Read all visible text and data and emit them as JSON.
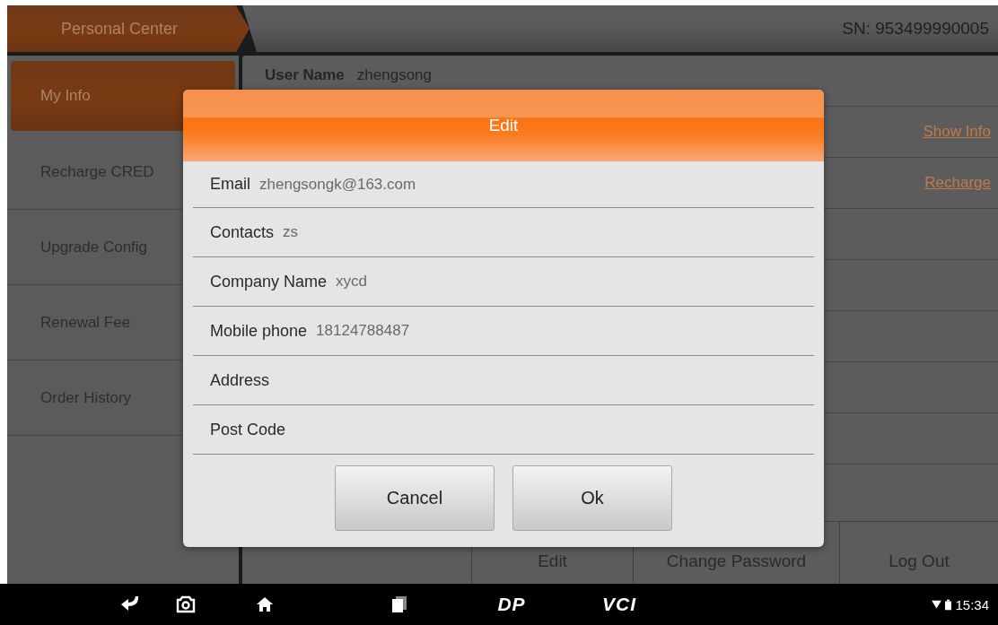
{
  "header": {
    "title": "Personal Center",
    "serial": "SN: 953499990005"
  },
  "sidebar": {
    "items": [
      {
        "label": "My Info",
        "selected": true
      },
      {
        "label": "Recharge CRED",
        "selected": false
      },
      {
        "label": "Upgrade Config",
        "selected": false
      },
      {
        "label": "Renewal Fee",
        "selected": false
      },
      {
        "label": "Order History",
        "selected": false
      }
    ]
  },
  "content": {
    "user_name": {
      "label": "User Name",
      "value": "zhengsong"
    },
    "links": [
      "Show Info",
      "Recharge"
    ],
    "bottom_tabs": [
      "Edit",
      "Change Password",
      "Log Out"
    ]
  },
  "dialog": {
    "title": "Edit",
    "fields": [
      {
        "label": "Email",
        "value": "zhengsongk@163.com"
      },
      {
        "label": "Contacts",
        "value": "zs"
      },
      {
        "label": "Company Name",
        "value": "xycd"
      },
      {
        "label": "Mobile phone",
        "value": "18124788487"
      },
      {
        "label": "Address"
      },
      {
        "label": "Post Code"
      }
    ],
    "buttons": [
      "Cancel",
      "Ok"
    ]
  },
  "navbar": {
    "brand_labels": [
      "DP",
      "VCI"
    ],
    "time": "15:34"
  }
}
